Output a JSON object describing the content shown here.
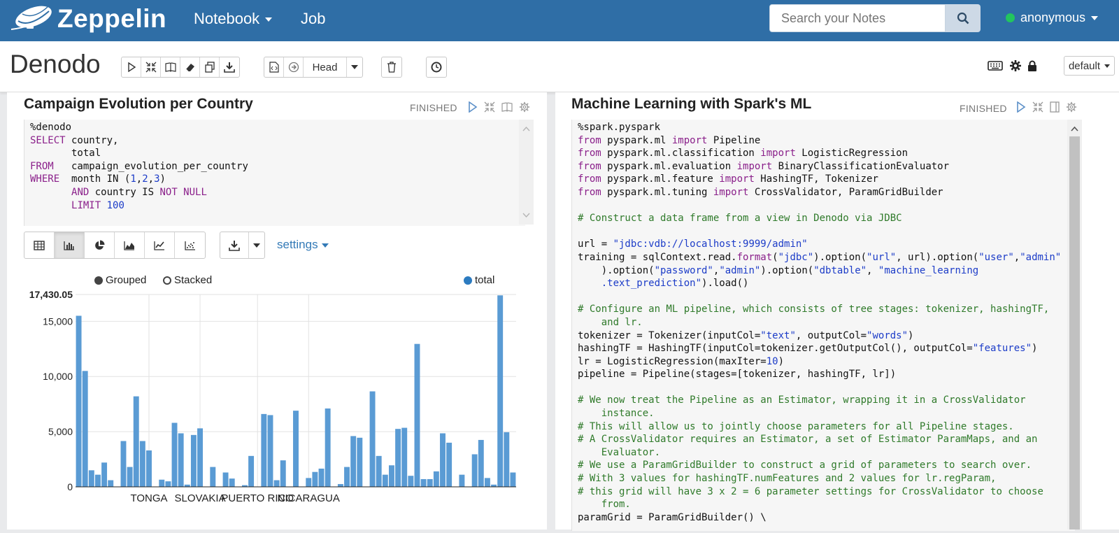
{
  "navbar": {
    "brand": "Zeppelin",
    "notebook_label": "Notebook",
    "job_label": "Job",
    "search_placeholder": "Search your Notes",
    "user": "anonymous",
    "user_status_color": "#22c55e"
  },
  "toolbar": {
    "notebook_title": "Denodo",
    "version_label": "Head",
    "interpreter_label": "default"
  },
  "left_paragraph": {
    "title": "Campaign Evolution per Country",
    "status": "FINISHED",
    "code": [
      [
        [
          "t",
          "%denodo"
        ]
      ],
      [
        [
          "k",
          "SELECT"
        ],
        [
          "t",
          " country,"
        ]
      ],
      [
        [
          "t",
          "       total"
        ]
      ],
      [
        [
          "k",
          "FROM"
        ],
        [
          "t",
          "   campaign_evolution_per_country"
        ]
      ],
      [
        [
          "k",
          "WHERE"
        ],
        [
          "t",
          "  month IN ("
        ],
        [
          "n",
          "1"
        ],
        [
          "t",
          ","
        ],
        [
          "n",
          "2"
        ],
        [
          "t",
          ","
        ],
        [
          "n",
          "3"
        ],
        [
          "t",
          ")"
        ]
      ],
      [
        [
          "t",
          "       "
        ],
        [
          "k",
          "AND"
        ],
        [
          "t",
          " country IS "
        ],
        [
          "k",
          "NOT NULL"
        ]
      ],
      [
        [
          "t",
          "       "
        ],
        [
          "k",
          "LIMIT"
        ],
        [
          "t",
          " "
        ],
        [
          "n",
          "100"
        ]
      ]
    ],
    "settings_label": "settings",
    "legend": {
      "grouped": "Grouped",
      "stacked": "Stacked",
      "series": "total"
    }
  },
  "chart_data": {
    "type": "bar",
    "series": [
      {
        "name": "total",
        "color": "#5a9bd4"
      }
    ],
    "ylim": [
      0,
      17430.05
    ],
    "yticks": [
      "17,430.05",
      "15,000",
      "10,000",
      "5,000",
      "0"
    ],
    "ytick_values": [
      17430.05,
      15000,
      10000,
      5000,
      0
    ],
    "xtick_labels": [
      "TONGA",
      "SLOVAKIA",
      "PUERTO RICO",
      "NICARAGUA"
    ],
    "xtick_positions": [
      11,
      19,
      28,
      36
    ],
    "values": [
      15500,
      10500,
      1500,
      1100,
      2200,
      600,
      0,
      4150,
      1800,
      8200,
      4150,
      3300,
      0,
      650,
      500,
      5800,
      4850,
      200,
      4700,
      5300,
      0,
      1800,
      0,
      1300,
      750,
      0,
      150,
      2800,
      0,
      6600,
      6500,
      600,
      2400,
      0,
      6900,
      0,
      800,
      1350,
      1650,
      7100,
      0,
      250,
      1800,
      4600,
      4450,
      0,
      8650,
      2800,
      1100,
      1950,
      5250,
      5350,
      1000,
      12950,
      700,
      700,
      1400,
      4850,
      4000,
      0,
      1100,
      0,
      2950,
      4250,
      800,
      200,
      17350,
      4950,
      1300
    ]
  },
  "right_paragraph": {
    "title": "Machine Learning with Spark's ML",
    "status": "FINISHED",
    "code": [
      [
        [
          "t",
          "%spark.pyspark"
        ]
      ],
      [
        [
          "k",
          "from"
        ],
        [
          "t",
          " pyspark.ml "
        ],
        [
          "k",
          "import"
        ],
        [
          "t",
          " Pipeline"
        ]
      ],
      [
        [
          "k",
          "from"
        ],
        [
          "t",
          " pyspark.ml.classification "
        ],
        [
          "k",
          "import"
        ],
        [
          "t",
          " LogisticRegression"
        ]
      ],
      [
        [
          "k",
          "from"
        ],
        [
          "t",
          " pyspark.ml.evaluation "
        ],
        [
          "k",
          "import"
        ],
        [
          "t",
          " BinaryClassificationEvaluator"
        ]
      ],
      [
        [
          "k",
          "from"
        ],
        [
          "t",
          " pyspark.ml.feature "
        ],
        [
          "k",
          "import"
        ],
        [
          "t",
          " HashingTF, Tokenizer"
        ]
      ],
      [
        [
          "k",
          "from"
        ],
        [
          "t",
          " pyspark.ml.tuning "
        ],
        [
          "k",
          "import"
        ],
        [
          "t",
          " CrossValidator, ParamGridBuilder"
        ]
      ],
      [
        [
          "t",
          ""
        ]
      ],
      [
        [
          "c",
          "# Construct a data frame from a view in Denodo via JDBC"
        ]
      ],
      [
        [
          "t",
          ""
        ]
      ],
      [
        [
          "t",
          "url = "
        ],
        [
          "s",
          "\"jdbc:vdb://localhost:9999/admin\""
        ]
      ],
      [
        [
          "t",
          "training = sqlContext.read."
        ],
        [
          "k",
          "format"
        ],
        [
          "t",
          "("
        ],
        [
          "s",
          "\"jdbc\""
        ],
        [
          "t",
          ").option("
        ],
        [
          "s",
          "\"url\""
        ],
        [
          "t",
          ", url).option("
        ],
        [
          "s",
          "\"user\""
        ],
        [
          "t",
          ","
        ],
        [
          "s",
          "\"admin\""
        ]
      ],
      [
        [
          "t",
          "    ).option("
        ],
        [
          "s",
          "\"password\""
        ],
        [
          "t",
          ","
        ],
        [
          "s",
          "\"admin\""
        ],
        [
          "t",
          ").option("
        ],
        [
          "s",
          "\"dbtable\""
        ],
        [
          "t",
          ", "
        ],
        [
          "s",
          "\"machine_learning"
        ]
      ],
      [
        [
          "s",
          "    .text_prediction\""
        ],
        [
          "t",
          ").load()"
        ]
      ],
      [
        [
          "t",
          ""
        ]
      ],
      [
        [
          "c",
          "# Configure an ML pipeline, which consists of tree stages: tokenizer, hashingTF,"
        ]
      ],
      [
        [
          "c",
          "    and lr."
        ]
      ],
      [
        [
          "t",
          "tokenizer = Tokenizer(inputCol="
        ],
        [
          "s",
          "\"text\""
        ],
        [
          "t",
          ", outputCol="
        ],
        [
          "s",
          "\"words\""
        ],
        [
          "t",
          ")"
        ]
      ],
      [
        [
          "t",
          "hashingTF = HashingTF(inputCol=tokenizer.getOutputCol(), outputCol="
        ],
        [
          "s",
          "\"features\""
        ],
        [
          "t",
          ")"
        ]
      ],
      [
        [
          "t",
          "lr = LogisticRegression(maxIter="
        ],
        [
          "n",
          "10"
        ],
        [
          "t",
          ")"
        ]
      ],
      [
        [
          "t",
          "pipeline = Pipeline(stages=[tokenizer, hashingTF, lr])"
        ]
      ],
      [
        [
          "t",
          ""
        ]
      ],
      [
        [
          "c",
          "# We now treat the Pipeline as an Estimator, wrapping it in a CrossValidator"
        ]
      ],
      [
        [
          "c",
          "    instance."
        ]
      ],
      [
        [
          "c",
          "# This will allow us to jointly choose parameters for all Pipeline stages."
        ]
      ],
      [
        [
          "c",
          "# A CrossValidator requires an Estimator, a set of Estimator ParamMaps, and an"
        ]
      ],
      [
        [
          "c",
          "    Evaluator."
        ]
      ],
      [
        [
          "c",
          "# We use a ParamGridBuilder to construct a grid of parameters to search over."
        ]
      ],
      [
        [
          "c",
          "# With 3 values for hashingTF.numFeatures and 2 values for lr.regParam,"
        ]
      ],
      [
        [
          "c",
          "# this grid will have 3 x 2 = 6 parameter settings for CrossValidator to choose"
        ]
      ],
      [
        [
          "c",
          "    from."
        ]
      ],
      [
        [
          "t",
          "paramGrid = ParamGridBuilder() \\"
        ]
      ]
    ]
  }
}
